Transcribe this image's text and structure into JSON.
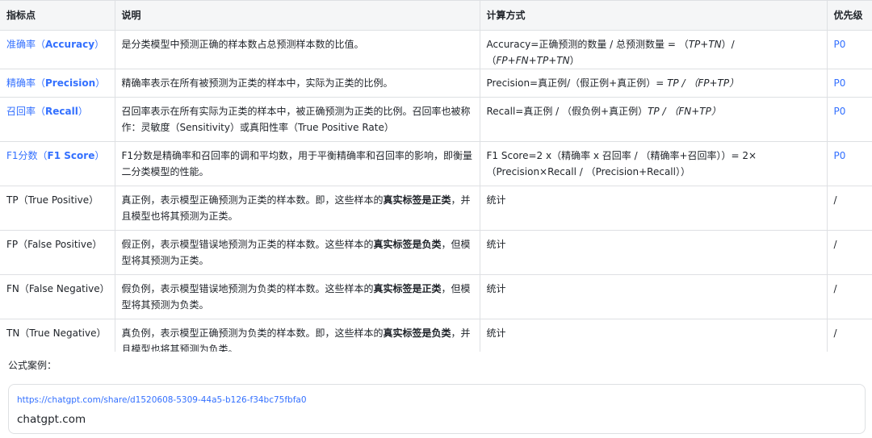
{
  "table": {
    "headers": [
      "指标点",
      "说明",
      "计算方式",
      "优先级"
    ],
    "rows": [
      {
        "metric_cn": "准确率（",
        "metric_en": "Accuracy",
        "metric_end": "）",
        "desc": "是分类模型中预测正确的样本数占总预测样本数的比值。",
        "calc_prefix": "Accuracy=正确预测的数量 / 总预测数量 = （",
        "calc_italic": "TP+TN",
        "calc_mid": "）/ （",
        "calc_italic2": "FP+FN+TP+TN",
        "calc_end": "）",
        "priority": "P0"
      },
      {
        "metric_cn": "精确率（",
        "metric_en": "Precision",
        "metric_end": "）",
        "desc": "精确率表示在所有被预测为正类的样本中，实际为正类的比例。",
        "calc_prefix": "Precision=真正例/（假正例+真正例）=",
        "calc_italic": " TP / （FP+TP）",
        "priority": "P0"
      },
      {
        "metric_cn": "召回率（",
        "metric_en": "Recall",
        "metric_end": "）",
        "desc": "召回率表示在所有实际为正类的样本中，被正确预测为正类的比例。召回率也被称作：灵敏度（Sensitivity）或真阳性率（True Positive Rate）",
        "calc_prefix": "Recall=真正例 / （假负例+真正例）",
        "calc_italic": "TP / （FN+TP）",
        "priority": "P0"
      },
      {
        "metric_cn": "F1分数（",
        "metric_en": "F1 Score",
        "metric_end": "）",
        "desc": "F1分数是精确率和召回率的调和平均数，用于平衡精确率和召回率的影响，即衡量二分类模型的性能。",
        "calc_prefix": "F1 Score=2 x（精确率 x 召回率 / （精确率+召回率））= 2×（Precision×Recall / （Precision+Recall））",
        "priority": "P0"
      },
      {
        "metric_plain": "TP（True Positive）",
        "desc_pre": "真正例，表示模型正确预测为正类的样本数。即，这些样本的",
        "desc_bold": "真实标签是正类",
        "desc_post": "，并且模型也将其预测为正类。",
        "calc_prefix": "统计",
        "priority": "/"
      },
      {
        "metric_plain": "FP（False Positive）",
        "desc_pre": "假正例，表示模型错误地预测为正类的样本数。这些样本的",
        "desc_bold": "真实标签是负类",
        "desc_post": "，但模型将其预测为正类。",
        "calc_prefix": "统计",
        "priority": "/"
      },
      {
        "metric_plain": "FN（False Negative）",
        "desc_pre": "假负例，表示模型错误地预测为负类的样本数。这些样本的",
        "desc_bold": "真实标签是正类",
        "desc_post": "，但模型将其预测为负类。",
        "calc_prefix": "统计",
        "priority": "/"
      },
      {
        "metric_plain": "TN（True Negative）",
        "desc_pre": "真负例，表示模型正确预测为负类的样本数。即，这些样本的",
        "desc_bold": "真实标签是负类",
        "desc_post": "，并且模型也将其预测为负类。",
        "calc_prefix": "统计",
        "priority": "/"
      }
    ]
  },
  "footer": {
    "label": "公式案例：",
    "link_url": "https://chatgpt.com/share/d1520608-5309-44a5-b126-f34bc75fbfa0",
    "link_title": "chatgpt.com"
  },
  "colors": {
    "link": "#3370ff",
    "header_bg": "#f5f6f7",
    "border": "#dee0e3",
    "text": "#1f2329"
  }
}
